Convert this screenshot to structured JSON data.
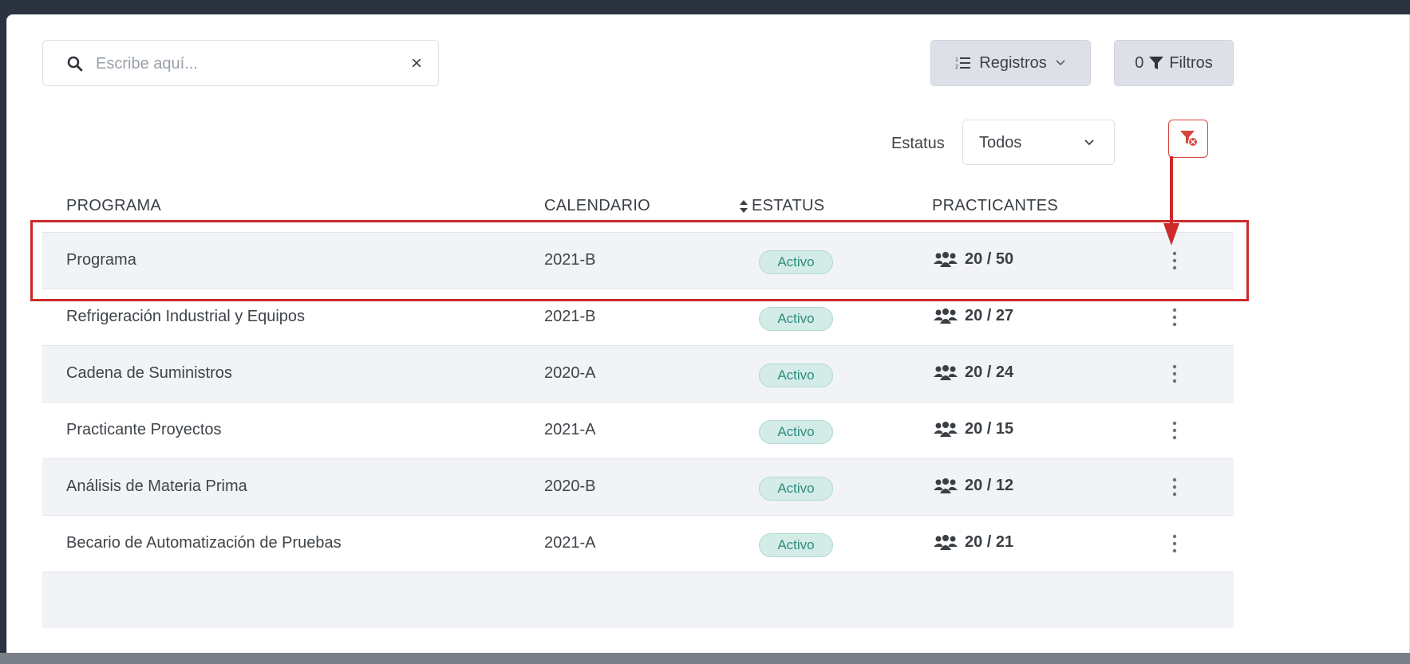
{
  "search": {
    "placeholder": "Escribe aquí...",
    "value": "",
    "clear_symbol": "×"
  },
  "toolbar": {
    "registros_label": "Registros",
    "filtros_count": "0",
    "filtros_label": "Filtros"
  },
  "status_filter": {
    "label": "Estatus",
    "selected": "Todos"
  },
  "table": {
    "headers": {
      "programa": "PROGRAMA",
      "calendario": "CALENDARIO",
      "estatus": "ESTATUS",
      "practicantes": "PRACTICANTES"
    },
    "rows": [
      {
        "programa": "Programa",
        "calendario": "2021-B",
        "estatus": "Activo",
        "practicantes": "20 / 50"
      },
      {
        "programa": "Refrigeración Industrial y Equipos",
        "calendario": "2021-B",
        "estatus": "Activo",
        "practicantes": "20 / 27"
      },
      {
        "programa": "Cadena de Suministros",
        "calendario": "2020-A",
        "estatus": "Activo",
        "practicantes": "20 / 24"
      },
      {
        "programa": "Practicante Proyectos",
        "calendario": "2021-A",
        "estatus": "Activo",
        "practicantes": "20 / 15"
      },
      {
        "programa": "Análisis de Materia Prima",
        "calendario": "2020-B",
        "estatus": "Activo",
        "practicantes": "20 / 12"
      },
      {
        "programa": "Becario de Automatización de Pruebas",
        "calendario": "2021-A",
        "estatus": "Activo",
        "practicantes": "20 / 21"
      }
    ]
  },
  "icons": {
    "search": "search-icon",
    "clear": "close-icon",
    "list": "list-ordered-icon",
    "chevron": "chevron-down-icon",
    "filter": "filter-icon",
    "clear_filter": "filter-remove-icon",
    "users": "users-icon",
    "more": "more-vertical-icon",
    "sort": "sort-icon"
  },
  "colors": {
    "badge_bg": "#d3ece8",
    "badge_text": "#2e8b7c",
    "annotation": "#cc2a2a",
    "button_bg": "#dde1e7"
  }
}
